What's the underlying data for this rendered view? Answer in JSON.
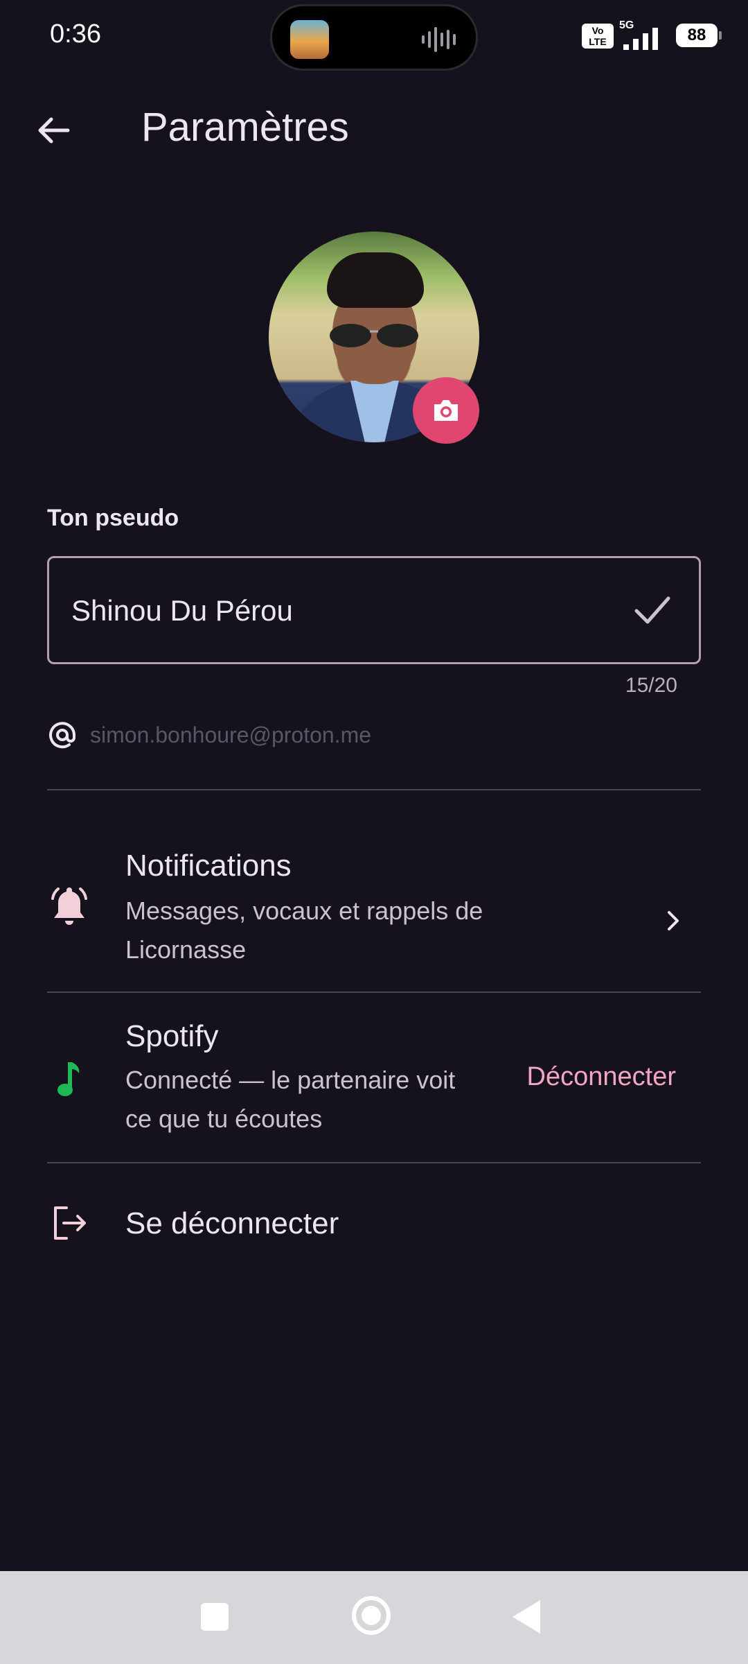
{
  "status_bar": {
    "time": "0:36",
    "volte_label": "Vo\nLTE",
    "network": "5G",
    "battery": "88"
  },
  "header": {
    "title": "Paramètres"
  },
  "profile": {
    "pseudo_label": "Ton pseudo",
    "pseudo_value": "Shinou Du Pérou",
    "char_counter": "15/20",
    "email": "simon.bonhoure@proton.me"
  },
  "settings": {
    "notifications": {
      "title": "Notifications",
      "subtitle": "Messages, vocaux et rappels de Licornasse"
    },
    "spotify": {
      "title": "Spotify",
      "subtitle": "Connecté — le partenaire voit ce que tu écoutes",
      "action": "Déconnecter"
    },
    "logout": {
      "title": "Se déconnecter"
    }
  },
  "colors": {
    "background": "#16121d",
    "accent": "#e0466f",
    "link": "#f3a6c1",
    "spotify_green": "#1db954"
  },
  "icons": [
    "back-arrow-icon",
    "camera-icon",
    "check-icon",
    "at-icon",
    "bell-icon",
    "chevron-right-icon",
    "music-note-icon",
    "logout-icon"
  ]
}
